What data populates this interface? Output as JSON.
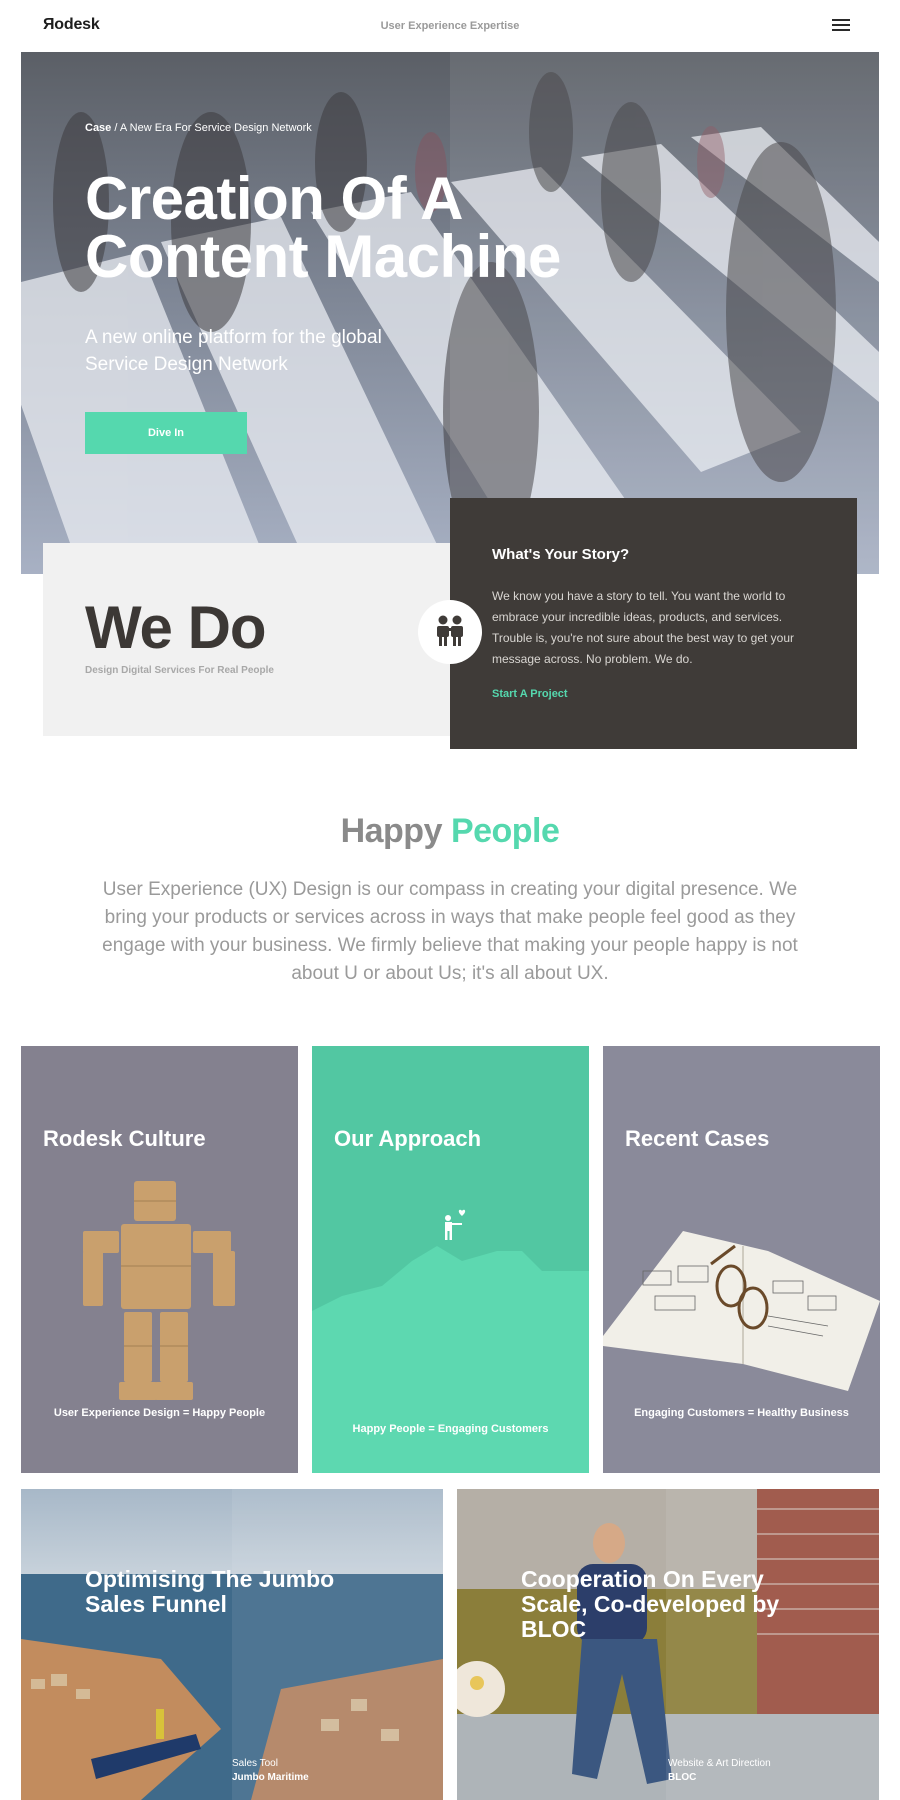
{
  "header": {
    "logo": "Яodesk",
    "tagline": "User Experience Expertise"
  },
  "hero": {
    "breadcrumb_case": "Case",
    "breadcrumb_sep": " / ",
    "breadcrumb_title": "A New Era For Service Design Network",
    "title_line1": "Creation Of A",
    "title_line2": "Content Machine",
    "subtitle": "A new online platform for the global Service Design Network",
    "cta_label": "Dive In"
  },
  "wedo": {
    "title": "We Do",
    "subtitle": "Design Digital Services For Real People"
  },
  "story": {
    "title": "What's Your Story?",
    "text": "We know you have a story to tell. You want the world to embrace your incredible ideas, products, and services. Trouble is, you're not sure about the best way to get your message across. No problem. We do.",
    "link": "Start A Project"
  },
  "happy": {
    "title_part1": "Happy ",
    "title_part2": "People",
    "text": "User Experience (UX) Design is our compass in creating your digital presence. We bring your products or services across in ways that make people feel good as they engage with your business. We firmly believe that making your people happy is not about U or about Us; it's all about UX."
  },
  "cards": [
    {
      "title": "Rodesk Culture",
      "caption": "User Experience Design = Happy People"
    },
    {
      "title": "Our Approach",
      "caption": "Happy People = Engaging Customers"
    },
    {
      "title": "Recent Cases",
      "caption": "Engaging Customers = Healthy Business"
    }
  ],
  "cases": [
    {
      "title": "Optimising The Jumbo Sales Funnel",
      "meta_line1": "Sales Tool",
      "meta_line2": "Jumbo Maritime"
    },
    {
      "title": "Cooperation On Every Scale, Co-developed by BLOC",
      "meta_line1": "Website & Art Direction",
      "meta_line2": "BLOC"
    }
  ],
  "colors": {
    "accent": "#55d8ae",
    "dark": "#3f3b38",
    "light_panel": "#f1f1f1"
  },
  "icons": [
    "menu-icon",
    "people-icon",
    "person-heart-icon"
  ]
}
